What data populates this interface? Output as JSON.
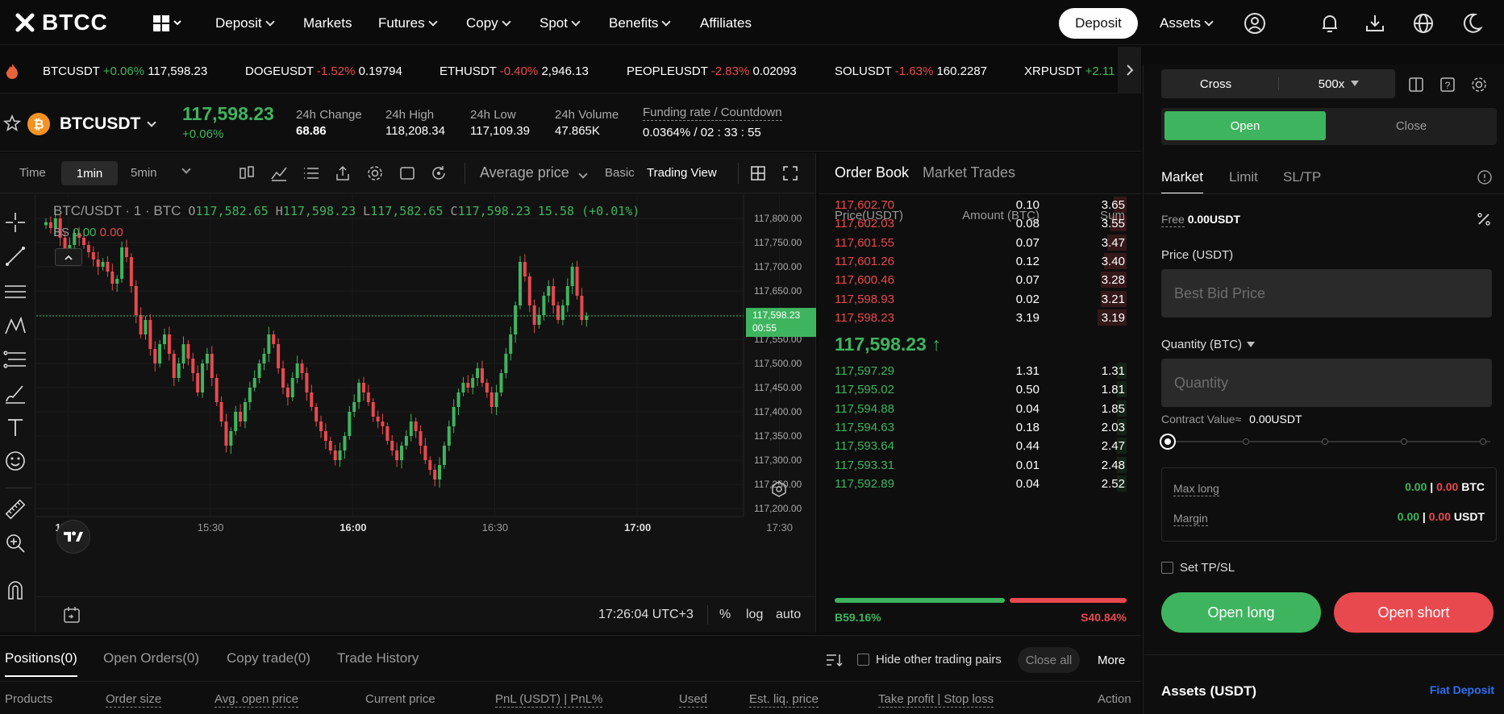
{
  "nav": {
    "brand": "BTCC",
    "items": [
      "Deposit",
      "Markets",
      "Futures",
      "Copy",
      "Spot",
      "Benefits",
      "Affiliates"
    ],
    "deposit_button": "Deposit",
    "assets": "Assets"
  },
  "ticker": [
    {
      "sym": "BTCUSDT",
      "chg": "+0.06%",
      "price": "117,598.23",
      "up": true
    },
    {
      "sym": "DOGEUSDT",
      "chg": "-1.52%",
      "price": "0.19794",
      "up": false
    },
    {
      "sym": "ETHUSDT",
      "chg": "-0.40%",
      "price": "2,946.13",
      "up": false
    },
    {
      "sym": "PEOPLEUSDT",
      "chg": "-2.83%",
      "price": "0.02093",
      "up": false
    },
    {
      "sym": "SOLUSDT",
      "chg": "-1.63%",
      "price": "160.2287",
      "up": false
    },
    {
      "sym": "XRPUSDT",
      "chg": "+2.11",
      "price": "",
      "up": true
    }
  ],
  "symbol": {
    "name": "BTCUSDT",
    "price": "117,598.23",
    "change_pct": "+0.06%",
    "change_label": "24h Change",
    "change_value": "68.86",
    "high_label": "24h High",
    "high_value": "118,208.34",
    "low_label": "24h Low",
    "low_value": "117,109.39",
    "volume_label": "24h Volume",
    "volume_value": "47.865K",
    "funding_label": "Funding rate / Countdown",
    "funding_value": "0.0364% / 02 : 33 : 55"
  },
  "chart_toolbar": {
    "time": "Time",
    "active_interval": "1min",
    "interval2": "5min",
    "price_type": "Average price",
    "basic": "Basic",
    "trading_view": "Trading View"
  },
  "chart_info": {
    "title": "BTC/USDT · 1 · BTC",
    "o_label": "O",
    "o": "117,582.65",
    "h_label": "H",
    "h": "117,598.23",
    "l_label": "L",
    "l": "117,582.65",
    "c_label": "C",
    "c": "117,598.23",
    "chg": "15.58 (+0.01%)",
    "bs_label": "BS",
    "bs_buy": "0.00",
    "bs_sell": "0.00"
  },
  "chart_footer": {
    "time": "17:26:04 UTC+3",
    "pct": "%",
    "log": "log",
    "auto": "auto"
  },
  "chart_data": {
    "type": "candlestick",
    "y_ticks": [
      "117,800.00",
      "117,750.00",
      "117,700.00",
      "117,650.00",
      "117,600.00",
      "117,550.00",
      "117,500.00",
      "117,450.00",
      "117,400.00",
      "117,350.00",
      "117,300.00",
      "117,250.00",
      "117,200.00"
    ],
    "x_ticks": [
      "15:00",
      "15:30",
      "16:00",
      "16:30",
      "17:00",
      "17:30"
    ],
    "ylim": [
      117200,
      117820
    ],
    "last_price_label": "117,598.23",
    "last_price_countdown": "00:55",
    "last_price": 117598.23,
    "closes": [
      117792,
      117780,
      117800,
      117760,
      117735,
      117745,
      117770,
      117760,
      117745,
      117730,
      117715,
      117700,
      117710,
      117690,
      117665,
      117675,
      117740,
      117720,
      117660,
      117600,
      117560,
      117590,
      117530,
      117500,
      117540,
      117560,
      117520,
      117470,
      117500,
      117540,
      117510,
      117480,
      117440,
      117500,
      117520,
      117470,
      117420,
      117380,
      117330,
      117360,
      117400,
      117380,
      117420,
      117450,
      117470,
      117500,
      117520,
      117560,
      117540,
      117490,
      117450,
      117430,
      117470,
      117500,
      117480,
      117440,
      117410,
      117380,
      117360,
      117340,
      117320,
      117300,
      117320,
      117350,
      117400,
      117420,
      117460,
      117440,
      117420,
      117390,
      117380,
      117370,
      117340,
      117320,
      117300,
      117330,
      117350,
      117380,
      117360,
      117330,
      117300,
      117280,
      117260,
      117290,
      117330,
      117370,
      117410,
      117440,
      117460,
      117450,
      117470,
      117490,
      117460,
      117440,
      117410,
      117440,
      117480,
      117520,
      117560,
      117620,
      117710,
      117680,
      117620,
      117580,
      117600,
      117640,
      117660,
      117620,
      117590,
      117620,
      117660,
      117700,
      117640,
      117590,
      117598
    ]
  },
  "orderbook": {
    "tabs": [
      "Order Book",
      "Market Trades"
    ],
    "headers": [
      "Price(USDT)",
      "Amount (BTC)",
      "Sum"
    ],
    "asks": [
      {
        "price": "117,602.70",
        "amount": "0.10",
        "sum": "3.65",
        "depth": 0.04
      },
      {
        "price": "117,602.03",
        "amount": "0.08",
        "sum": "3.55",
        "depth": 0.05
      },
      {
        "price": "117,601.55",
        "amount": "0.07",
        "sum": "3.47",
        "depth": 0.06
      },
      {
        "price": "117,601.26",
        "amount": "0.12",
        "sum": "3.40",
        "depth": 0.07
      },
      {
        "price": "117,600.46",
        "amount": "0.07",
        "sum": "3.28",
        "depth": 0.08
      },
      {
        "price": "117,598.93",
        "amount": "0.02",
        "sum": "3.21",
        "depth": 0.08
      },
      {
        "price": "117,598.23",
        "amount": "3.19",
        "sum": "3.19",
        "depth": 0.09
      }
    ],
    "mid_price": "117,598.23",
    "mid_arrow": "↑",
    "bids": [
      {
        "price": "117,597.29",
        "amount": "1.31",
        "sum": "1.31"
      },
      {
        "price": "117,595.02",
        "amount": "0.50",
        "sum": "1.81"
      },
      {
        "price": "117,594.88",
        "amount": "0.04",
        "sum": "1.85"
      },
      {
        "price": "117,594.63",
        "amount": "0.18",
        "sum": "2.03"
      },
      {
        "price": "117,593.64",
        "amount": "0.44",
        "sum": "2.47"
      },
      {
        "price": "117,593.31",
        "amount": "0.01",
        "sum": "2.48"
      },
      {
        "price": "117,592.89",
        "amount": "0.04",
        "sum": "2.52"
      }
    ],
    "buy_ratio": "B59.16%",
    "sell_ratio": "S40.84%",
    "buy_fraction": 0.5916
  },
  "trade": {
    "margin_mode": "Cross",
    "leverage": "500x",
    "open": "Open",
    "close": "Close",
    "order_types": [
      "Market",
      "Limit",
      "SL/TP"
    ],
    "free_label": "Free",
    "free_value": "0.00USDT",
    "price_label": "Price (USDT)",
    "price_placeholder": "Best Bid Price",
    "qty_label": "Quantity (BTC)",
    "qty_placeholder": "Quantity",
    "contract_label": "Contract Value≈",
    "contract_value": "0.00USDT",
    "max_long_label": "Max long",
    "max_long_g": "0.00",
    "max_long_r": "0.00",
    "max_long_unit": "BTC",
    "margin_label": "Margin",
    "margin_g": "0.00",
    "margin_r": "0.00",
    "margin_unit": "USDT",
    "tpsl_label": "Set TP/SL",
    "open_long": "Open long",
    "open_short": "Open short",
    "assets_label": "Assets (USDT)",
    "fiat_deposit": "Fiat Deposit"
  },
  "positions": {
    "tabs": [
      "Positions(0)",
      "Open Orders(0)",
      "Copy trade(0)",
      "Trade History"
    ],
    "hide_label": "Hide other trading pairs",
    "close_all": "Close all",
    "more": "More",
    "columns": [
      "Products",
      "Order size",
      "Avg. open price",
      "Current price",
      "PnL (USDT) | PnL%",
      "Used",
      "Est. liq. price",
      "Take profit | Stop loss",
      "Action"
    ]
  },
  "colors": {
    "up": "#3fb45f",
    "down": "#e8494e",
    "accent": "#3fb45f",
    "bg": "#0b0b0b"
  }
}
